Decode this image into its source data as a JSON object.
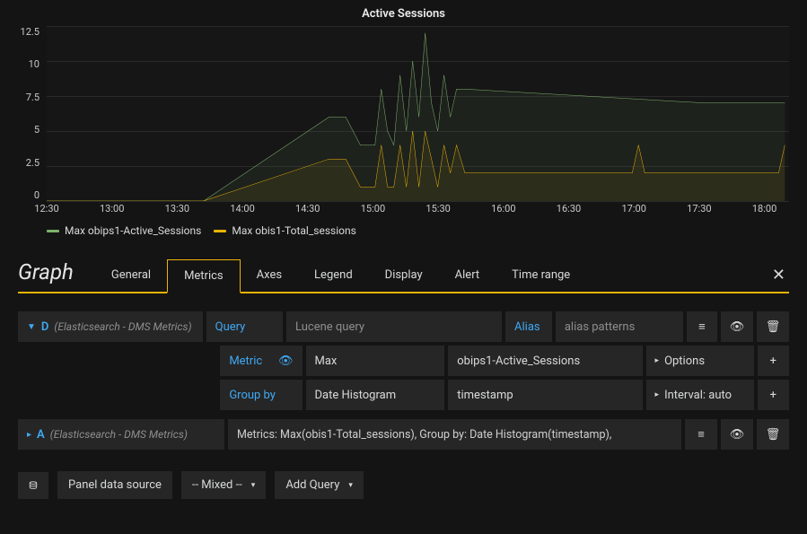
{
  "chart_data": {
    "type": "line",
    "title": "Active Sessions",
    "ylabel": "",
    "xlabel": "",
    "ylim": [
      0,
      12.5
    ],
    "yticks": [
      0,
      2.5,
      5.0,
      7.5,
      10.0,
      12.5
    ],
    "xticks": [
      "12:30",
      "13:00",
      "13:30",
      "14:00",
      "14:30",
      "15:00",
      "15:30",
      "16:00",
      "16:30",
      "17:00",
      "17:30",
      "18:00"
    ],
    "xrange_minutes": [
      735,
      1090
    ],
    "series": [
      {
        "name": "Max obips1-Active_Sessions",
        "color": "#7eb26d",
        "x_minutes": [
          735,
          810,
          870,
          878,
          885,
          892,
          895,
          898,
          901,
          904,
          907,
          910,
          913,
          916,
          919,
          922,
          925,
          928,
          931,
          935,
          1050,
          1088
        ],
        "values": [
          0,
          0,
          6,
          6,
          4,
          4,
          8,
          5,
          4,
          9,
          5,
          10,
          6,
          12,
          7,
          5,
          9,
          6,
          8,
          8,
          7,
          7
        ]
      },
      {
        "name": "Max obis1-Total_sessions",
        "color": "#eab305",
        "x_minutes": [
          735,
          810,
          870,
          878,
          885,
          892,
          895,
          898,
          901,
          904,
          907,
          910,
          913,
          916,
          919,
          922,
          925,
          928,
          931,
          935,
          1015,
          1018,
          1021,
          1024,
          1085,
          1088
        ],
        "values": [
          0,
          0,
          3,
          3,
          1,
          1,
          4,
          1,
          1,
          4,
          1,
          5,
          1,
          5,
          3,
          1,
          4,
          2,
          4,
          2,
          2,
          4,
          2,
          2,
          2,
          4
        ]
      }
    ]
  },
  "panel": {
    "type_label": "Graph",
    "tabs": [
      "General",
      "Metrics",
      "Axes",
      "Legend",
      "Display",
      "Alert",
      "Time range"
    ],
    "active_tab": "Metrics"
  },
  "queries": {
    "d": {
      "letter": "D",
      "source": "(Elasticsearch - DMS Metrics)",
      "query_label": "Query",
      "query_placeholder": "Lucene query",
      "alias_label": "Alias",
      "alias_placeholder": "alias patterns",
      "metric_label": "Metric",
      "metric_agg": "Max",
      "metric_field": "obips1-Active_Sessions",
      "options_label": "Options",
      "groupby_label": "Group by",
      "groupby_type": "Date Histogram",
      "groupby_field": "timestamp",
      "interval_label": "Interval: auto"
    },
    "a": {
      "letter": "A",
      "source": "(Elasticsearch - DMS Metrics)",
      "summary": "Metrics: Max(obis1-Total_sessions), Group by: Date Histogram(timestamp),"
    }
  },
  "footer": {
    "panel_ds_label": "Panel data source",
    "mixed_label": "-- Mixed --",
    "add_query_label": "Add Query"
  }
}
